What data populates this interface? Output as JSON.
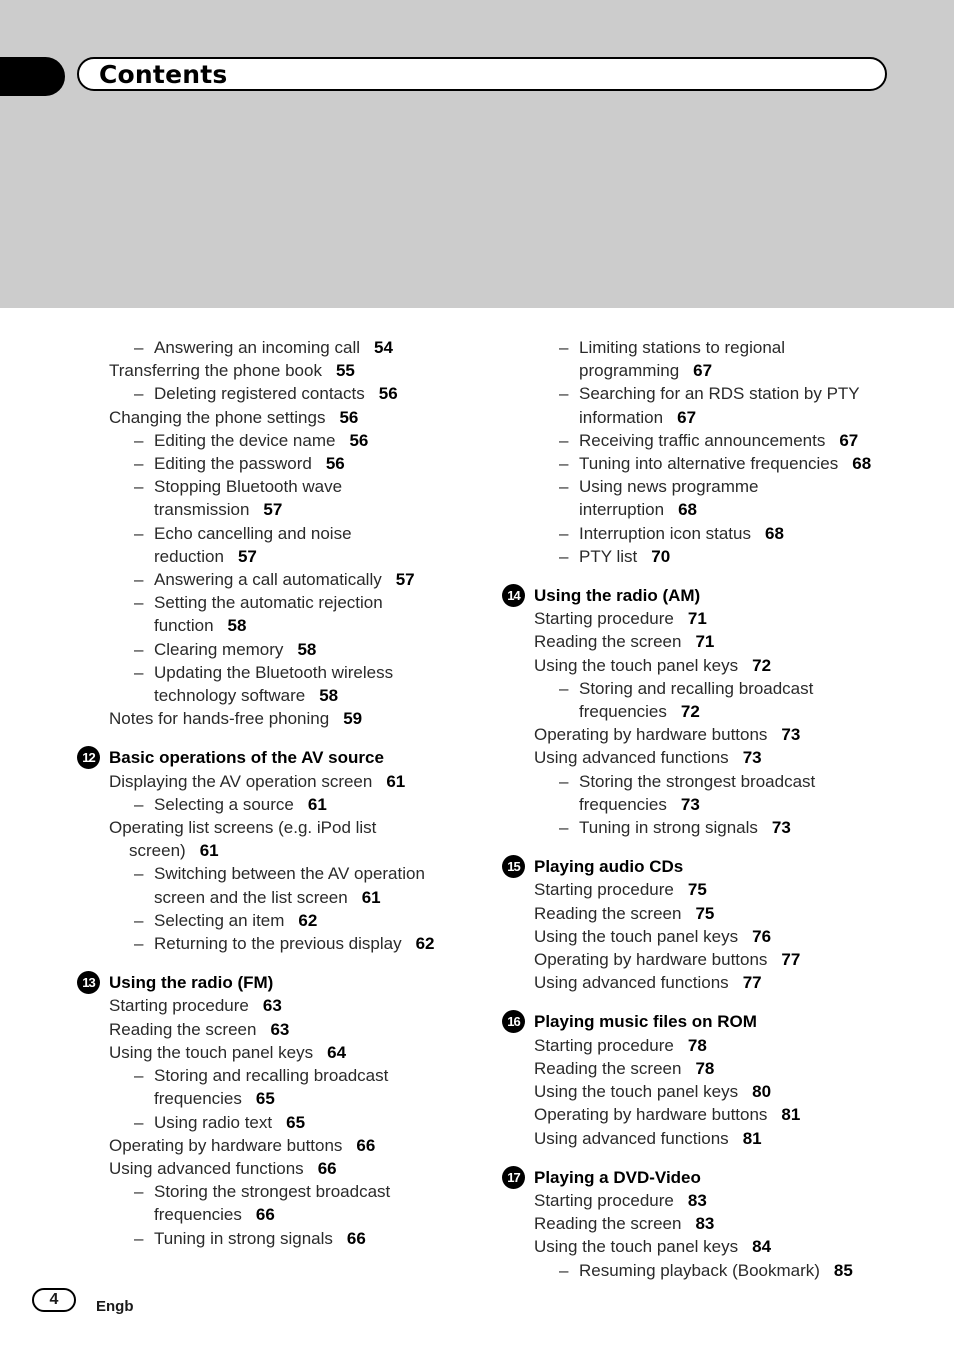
{
  "header": {
    "title": "Contents"
  },
  "left_column": [
    {
      "type": "sub",
      "text": "Answering an incoming call",
      "page": "54"
    },
    {
      "type": "item",
      "text": "Transferring the phone book",
      "page": "55"
    },
    {
      "type": "sub",
      "text": "Deleting registered contacts",
      "page": "56"
    },
    {
      "type": "item",
      "text": "Changing the phone settings",
      "page": "56"
    },
    {
      "type": "sub",
      "text": "Editing the device name",
      "page": "56"
    },
    {
      "type": "sub",
      "text": "Editing the password",
      "page": "56"
    },
    {
      "type": "sub",
      "text": "Stopping Bluetooth wave",
      "cont": "transmission",
      "page": "57"
    },
    {
      "type": "sub",
      "text": "Echo cancelling and noise",
      "cont": "reduction",
      "page": "57"
    },
    {
      "type": "sub",
      "text": "Answering a call automatically",
      "page": "57"
    },
    {
      "type": "sub",
      "text": "Setting the automatic rejection",
      "cont": "function",
      "page": "58"
    },
    {
      "type": "sub",
      "text": "Clearing memory",
      "page": "58"
    },
    {
      "type": "sub",
      "text": "Updating the Bluetooth wireless",
      "cont": "technology software",
      "page": "58"
    },
    {
      "type": "item",
      "text": "Notes for hands-free phoning",
      "page": "59"
    },
    {
      "type": "chapter",
      "num": "12",
      "text": "Basic operations of the AV source"
    },
    {
      "type": "item",
      "text": "Displaying the AV operation screen",
      "page": "61"
    },
    {
      "type": "sub",
      "text": "Selecting a source",
      "page": "61"
    },
    {
      "type": "item",
      "text": "Operating list screens (e.g. iPod list",
      "cont_item": "screen)",
      "page": "61"
    },
    {
      "type": "sub",
      "text": "Switching between the AV operation",
      "cont": "screen and the list screen",
      "page": "61"
    },
    {
      "type": "sub",
      "text": "Selecting an item",
      "page": "62"
    },
    {
      "type": "sub",
      "text": "Returning to the previous display",
      "page": "62"
    },
    {
      "type": "chapter",
      "num": "13",
      "text": "Using the radio (FM)"
    },
    {
      "type": "item",
      "text": "Starting procedure",
      "page": "63"
    },
    {
      "type": "item",
      "text": "Reading the screen",
      "page": "63"
    },
    {
      "type": "item",
      "text": "Using the touch panel keys",
      "page": "64"
    },
    {
      "type": "sub",
      "text": "Storing and recalling broadcast",
      "cont": "frequencies",
      "page": "65"
    },
    {
      "type": "sub",
      "text": "Using radio text",
      "page": "65"
    },
    {
      "type": "item",
      "text": "Operating by hardware buttons",
      "page": "66"
    },
    {
      "type": "item",
      "text": "Using advanced functions",
      "page": "66"
    },
    {
      "type": "sub",
      "text": "Storing the strongest broadcast",
      "cont": "frequencies",
      "page": "66"
    },
    {
      "type": "sub",
      "text": "Tuning in strong signals",
      "page": "66"
    }
  ],
  "right_column": [
    {
      "type": "sub",
      "text": "Limiting stations to regional",
      "cont": "programming",
      "page": "67"
    },
    {
      "type": "sub",
      "text": "Searching for an RDS station by PTY",
      "cont": "information",
      "page": "67"
    },
    {
      "type": "sub",
      "text": "Receiving traffic announcements",
      "page": "67"
    },
    {
      "type": "sub",
      "text": "Tuning into alternative frequencies",
      "page": "68"
    },
    {
      "type": "sub",
      "text": "Using news programme",
      "cont": "interruption",
      "page": "68"
    },
    {
      "type": "sub",
      "text": "Interruption icon status",
      "page": "68"
    },
    {
      "type": "sub",
      "text": "PTY list",
      "page": "70"
    },
    {
      "type": "chapter",
      "num": "14",
      "text": "Using the radio (AM)"
    },
    {
      "type": "item",
      "text": "Starting procedure",
      "page": "71"
    },
    {
      "type": "item",
      "text": "Reading the screen",
      "page": "71"
    },
    {
      "type": "item",
      "text": "Using the touch panel keys",
      "page": "72"
    },
    {
      "type": "sub",
      "text": "Storing and recalling broadcast",
      "cont": "frequencies",
      "page": "72"
    },
    {
      "type": "item",
      "text": "Operating by hardware buttons",
      "page": "73"
    },
    {
      "type": "item",
      "text": "Using advanced functions",
      "page": "73"
    },
    {
      "type": "sub",
      "text": "Storing the strongest broadcast",
      "cont": "frequencies",
      "page": "73"
    },
    {
      "type": "sub",
      "text": "Tuning in strong signals",
      "page": "73"
    },
    {
      "type": "chapter",
      "num": "15",
      "text": "Playing audio CDs"
    },
    {
      "type": "item",
      "text": "Starting procedure",
      "page": "75"
    },
    {
      "type": "item",
      "text": "Reading the screen",
      "page": "75"
    },
    {
      "type": "item",
      "text": "Using the touch panel keys",
      "page": "76"
    },
    {
      "type": "item",
      "text": "Operating by hardware buttons",
      "page": "77"
    },
    {
      "type": "item",
      "text": "Using advanced functions",
      "page": "77"
    },
    {
      "type": "chapter",
      "num": "16",
      "text": "Playing music files on ROM"
    },
    {
      "type": "item",
      "text": "Starting procedure",
      "page": "78"
    },
    {
      "type": "item",
      "text": "Reading the screen",
      "page": "78"
    },
    {
      "type": "item",
      "text": "Using the touch panel keys",
      "page": "80"
    },
    {
      "type": "item",
      "text": "Operating by hardware buttons",
      "page": "81"
    },
    {
      "type": "item",
      "text": "Using advanced functions",
      "page": "81"
    },
    {
      "type": "chapter",
      "num": "17",
      "text": "Playing a DVD-Video"
    },
    {
      "type": "item",
      "text": "Starting procedure",
      "page": "83"
    },
    {
      "type": "item",
      "text": "Reading the screen",
      "page": "83"
    },
    {
      "type": "item",
      "text": "Using the touch panel keys",
      "page": "84"
    },
    {
      "type": "sub",
      "text": "Resuming playback (Bookmark)",
      "page": "85"
    }
  ],
  "footer": {
    "page_number": "4",
    "language": "Engb"
  },
  "dash_glyph": "–"
}
